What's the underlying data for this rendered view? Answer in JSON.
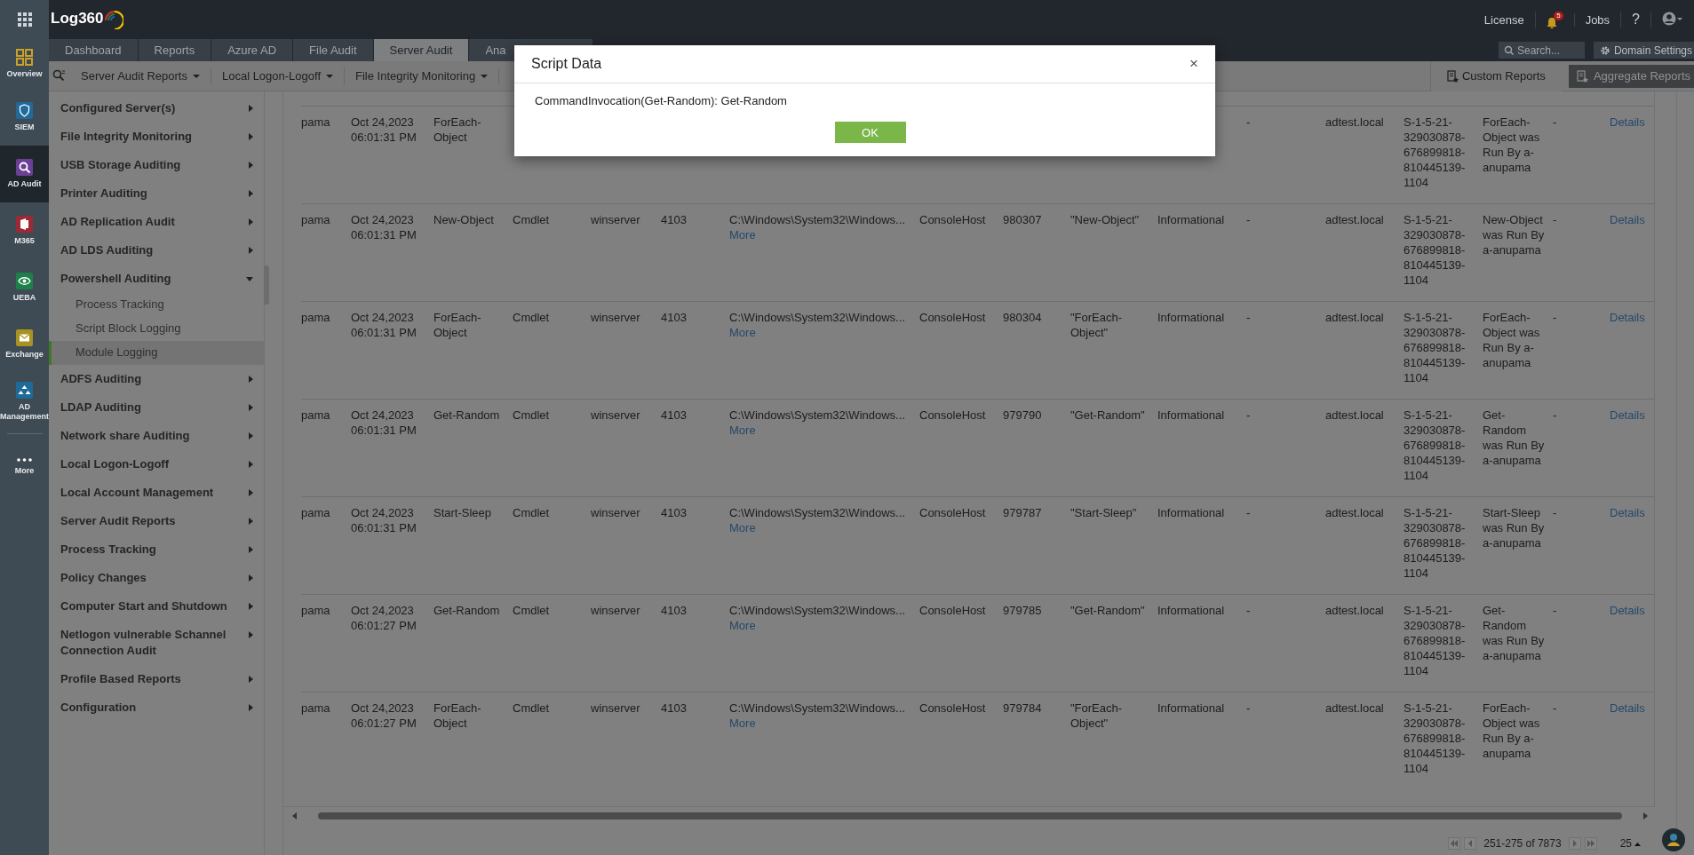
{
  "header": {
    "logo": "Log360",
    "license": "License",
    "notifications": "5",
    "jobs": "Jobs",
    "help": "?"
  },
  "rail": [
    {
      "label": "Overview",
      "kind": "overview",
      "color": "#c9a227",
      "selected": false
    },
    {
      "label": "SIEM",
      "kind": "shield",
      "color": "#1f6a98",
      "selected": false
    },
    {
      "label": "AD Audit",
      "kind": "search",
      "color": "#6a3f95",
      "selected": true
    },
    {
      "label": "M365",
      "kind": "office",
      "color": "#9c2a34",
      "selected": false
    },
    {
      "label": "UEBA",
      "kind": "eye",
      "color": "#1e8049",
      "selected": false
    },
    {
      "label": "Exchange",
      "kind": "mail",
      "color": "#a89222",
      "selected": false
    },
    {
      "label": "AD Management",
      "kind": "tree",
      "color": "#1f6a98",
      "selected": false
    },
    {
      "label": "More",
      "kind": "more",
      "selected": false
    }
  ],
  "tabs": [
    {
      "label": "Dashboard",
      "selected": false
    },
    {
      "label": "Reports",
      "selected": false
    },
    {
      "label": "Azure AD",
      "selected": false
    },
    {
      "label": "File Audit",
      "selected": false
    },
    {
      "label": "Server Audit",
      "selected": true
    },
    {
      "label": "Ana",
      "selected": false
    }
  ],
  "top_search": {
    "placeholder": "Search..."
  },
  "domain_settings": "Domain Settings",
  "toolbar": {
    "menus": [
      "Server Audit Reports",
      "Local Logon-Logoff",
      "File Integrity Monitoring"
    ],
    "custom_reports": "Custom Reports",
    "aggregate_reports": "Aggregate Reports"
  },
  "sidebar": {
    "items": [
      {
        "label": "Configured Server(s)",
        "expanded": false
      },
      {
        "label": "File Integrity Monitoring",
        "expanded": false
      },
      {
        "label": "USB Storage Auditing",
        "expanded": false
      },
      {
        "label": "Printer Auditing",
        "expanded": false
      },
      {
        "label": "AD Replication Audit",
        "expanded": false
      },
      {
        "label": "AD LDS Auditing",
        "expanded": false
      },
      {
        "label": "Powershell Auditing",
        "expanded": true,
        "children": [
          {
            "label": "Process Tracking",
            "selected": false
          },
          {
            "label": "Script Block Logging",
            "selected": false
          },
          {
            "label": "Module Logging",
            "selected": true
          }
        ]
      },
      {
        "label": "ADFS Auditing",
        "expanded": false
      },
      {
        "label": "LDAP Auditing",
        "expanded": false
      },
      {
        "label": "Network share Auditing",
        "expanded": false
      },
      {
        "label": "Local Logon-Logoff",
        "expanded": false
      },
      {
        "label": "Local Account Management",
        "expanded": false
      },
      {
        "label": "Server Audit Reports",
        "expanded": false
      },
      {
        "label": "Process Tracking",
        "expanded": false
      },
      {
        "label": "Policy Changes",
        "expanded": false
      },
      {
        "label": "Computer Start and Shutdown",
        "expanded": false
      },
      {
        "label": "Netlogon vulnerable Schannel Connection Audit",
        "expanded": false
      },
      {
        "label": "Profile Based Reports",
        "expanded": false
      },
      {
        "label": "Configuration",
        "expanded": false
      }
    ]
  },
  "table": {
    "rows": [
      {
        "cells": [
          "pama",
          "Oct 24,2023 06:01:31 PM",
          "ForEach-Object",
          null,
          null,
          null,
          null,
          null,
          null,
          null,
          null,
          "-",
          "adtest.local",
          "S-1-5-21-329030878-676899818-810445139-1104",
          "ForEach-Object was Run By a-anupama",
          "-"
        ],
        "details": "Details"
      },
      {
        "cells": [
          "pama",
          "Oct 24,2023 06:01:31 PM",
          "New-Object",
          "Cmdlet",
          "winserver",
          "4103",
          "C:\\Windows\\System32\\Windows...",
          "ConsoleHost",
          "980307",
          "\"New-Object\"",
          "Informational",
          "-",
          "adtest.local",
          "S-1-5-21-329030878-676899818-810445139-1104",
          "New-Object was Run By a-anupama",
          "-"
        ],
        "more": "More",
        "details": "Details"
      },
      {
        "cells": [
          "pama",
          "Oct 24,2023 06:01:31 PM",
          "ForEach-Object",
          "Cmdlet",
          "winserver",
          "4103",
          "C:\\Windows\\System32\\Windows...",
          "ConsoleHost",
          "980304",
          "\"ForEach-Object\"",
          "Informational",
          "-",
          "adtest.local",
          "S-1-5-21-329030878-676899818-810445139-1104",
          "ForEach-Object was Run By a-anupama",
          "-"
        ],
        "more": "More",
        "details": "Details"
      },
      {
        "cells": [
          "pama",
          "Oct 24,2023 06:01:31 PM",
          "Get-Random",
          "Cmdlet",
          "winserver",
          "4103",
          "C:\\Windows\\System32\\Windows...",
          "ConsoleHost",
          "979790",
          "\"Get-Random\"",
          "Informational",
          "-",
          "adtest.local",
          "S-1-5-21-329030878-676899818-810445139-1104",
          "Get-Random was Run By a-anupama",
          "-"
        ],
        "more": "More",
        "details": "Details"
      },
      {
        "cells": [
          "pama",
          "Oct 24,2023 06:01:31 PM",
          "Start-Sleep",
          "Cmdlet",
          "winserver",
          "4103",
          "C:\\Windows\\System32\\Windows...",
          "ConsoleHost",
          "979787",
          "\"Start-Sleep\"",
          "Informational",
          "-",
          "adtest.local",
          "S-1-5-21-329030878-676899818-810445139-1104",
          "Start-Sleep was Run By a-anupama",
          "-"
        ],
        "more": "More",
        "details": "Details"
      },
      {
        "cells": [
          "pama",
          "Oct 24,2023 06:01:27 PM",
          "Get-Random",
          "Cmdlet",
          "winserver",
          "4103",
          "C:\\Windows\\System32\\Windows...",
          "ConsoleHost",
          "979785",
          "\"Get-Random\"",
          "Informational",
          "-",
          "adtest.local",
          "S-1-5-21-329030878-676899818-810445139-1104",
          "Get-Random was Run By a-anupama",
          "-"
        ],
        "more": "More",
        "details": "Details"
      },
      {
        "cells": [
          "pama",
          "Oct 24,2023 06:01:27 PM",
          "ForEach-Object",
          "Cmdlet",
          "winserver",
          "4103",
          "C:\\Windows\\System32\\Windows...",
          "ConsoleHost",
          "979784",
          "\"ForEach-Object\"",
          "Informational",
          "-",
          "adtest.local",
          "S-1-5-21-329030878-676899818-810445139-1104",
          "ForEach-Object was Run By a-anupama",
          "-"
        ],
        "more": "More",
        "details": "Details"
      }
    ]
  },
  "pagination": {
    "range": "251-275 of 7873",
    "page_size": "25"
  },
  "modal": {
    "title": "Script Data",
    "close": "×",
    "body": "CommandInvocation(Get-Random): Get-Random",
    "button": "OK"
  }
}
